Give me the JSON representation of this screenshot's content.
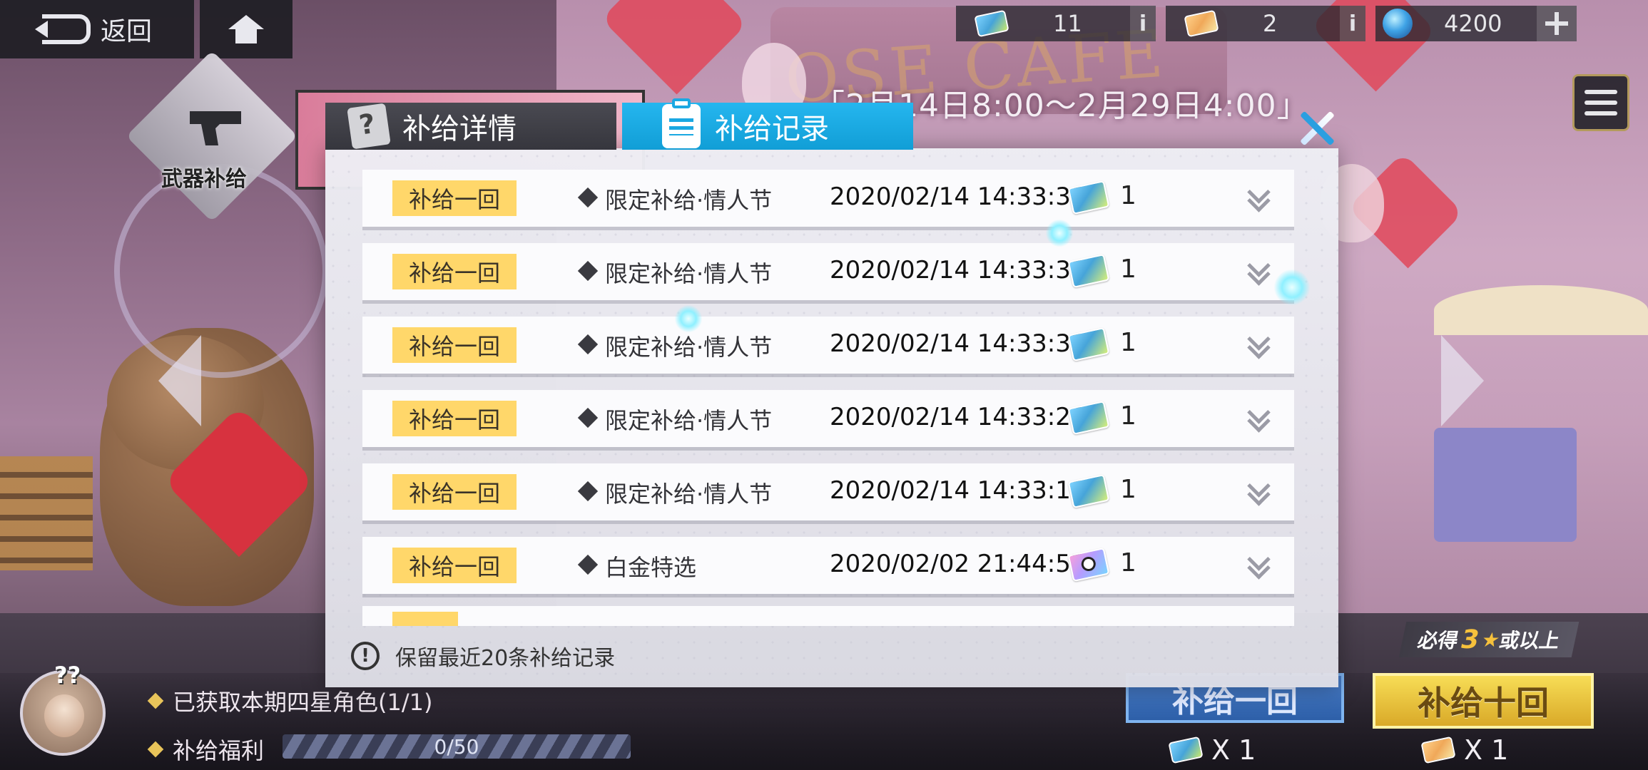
{
  "top_bar": {
    "back_label": "返回",
    "resources": [
      {
        "icon": "ticket-blue-icon",
        "count": "11"
      },
      {
        "icon": "ticket-gold-icon",
        "count": "2"
      },
      {
        "icon": "crystal-gem-icon",
        "count": "4200"
      }
    ],
    "info_label": "i"
  },
  "background": {
    "cafe_sign": "OSE CAFE",
    "weapon_label": "武器补给",
    "date_range": "「2月14日8:00～2月29日4:00」"
  },
  "modal": {
    "tabs": [
      {
        "label": "补给详情",
        "active": false
      },
      {
        "label": "补给记录",
        "active": true
      }
    ],
    "records": [
      {
        "badge": "补给一回",
        "name": "限定补给·情人节",
        "time": "2020/02/14 14:33:38",
        "item_icon": "ticket-blue-icon",
        "count": "1"
      },
      {
        "badge": "补给一回",
        "name": "限定补给·情人节",
        "time": "2020/02/14 14:33:35",
        "item_icon": "ticket-blue-icon",
        "count": "1"
      },
      {
        "badge": "补给一回",
        "name": "限定补给·情人节",
        "time": "2020/02/14 14:33:32",
        "item_icon": "ticket-blue-icon",
        "count": "1"
      },
      {
        "badge": "补给一回",
        "name": "限定补给·情人节",
        "time": "2020/02/14 14:33:26",
        "item_icon": "ticket-blue-icon",
        "count": "1"
      },
      {
        "badge": "补给一回",
        "name": "限定补给·情人节",
        "time": "2020/02/14 14:33:15",
        "item_icon": "ticket-blue-icon",
        "count": "1"
      },
      {
        "badge": "补给一回",
        "name": "白金特选",
        "time": "2020/02/02 21:44:57",
        "item_icon": "ticket-platinum-icon",
        "count": "1"
      }
    ],
    "footer_note": "保留最近20条补给记录",
    "footer_icon": "!"
  },
  "bottom": {
    "qmarks": "??",
    "line1": "已获取本期四星角色(1/1)",
    "line2": "补给福利",
    "progress_text": "0/50",
    "progress_value": 0,
    "guarantee_prefix": "必得",
    "guarantee_num": "3",
    "guarantee_star": "★",
    "guarantee_suffix": "或以上",
    "draw1_label": "补给一回",
    "draw10_label": "补给十回",
    "draw1_cost": "X 1",
    "draw10_cost": "X 1"
  },
  "colors": {
    "tab_active": "#1aa8e2",
    "badge": "#ffd76a",
    "draw10": "#f0c53c"
  }
}
